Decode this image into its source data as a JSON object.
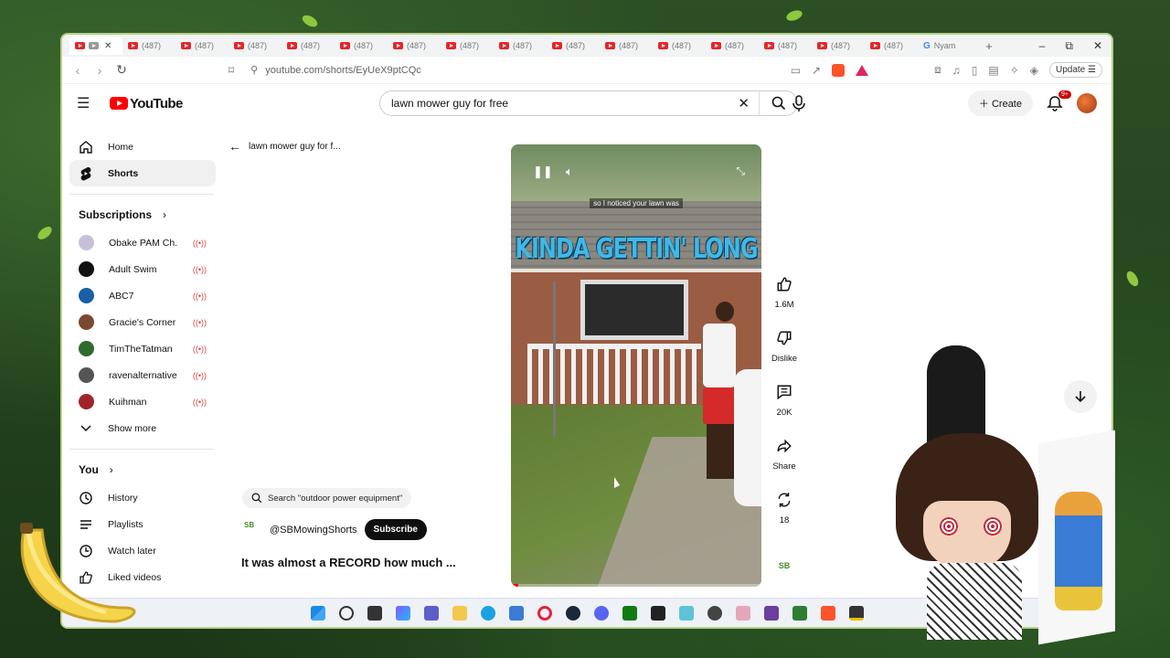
{
  "browser": {
    "tabs": [
      {
        "label": "",
        "active": true
      },
      {
        "label": "(487)"
      },
      {
        "label": "(487)"
      },
      {
        "label": "(487)"
      },
      {
        "label": "(487)"
      },
      {
        "label": "(487)"
      },
      {
        "label": "(487)"
      },
      {
        "label": "(487)"
      },
      {
        "label": "(487)"
      },
      {
        "label": "(487)"
      },
      {
        "label": "(487)"
      },
      {
        "label": "(487)"
      },
      {
        "label": "(487)"
      },
      {
        "label": "(487)"
      },
      {
        "label": "(487)"
      },
      {
        "label": "(487)"
      }
    ],
    "last_tab_label": "Nyam",
    "url": "youtube.com/shorts/EyUeX9ptCQc",
    "update_label": "Update"
  },
  "header": {
    "logo_text": "YouTube",
    "search_value": "lawn mower guy for free",
    "create_label": "Create",
    "notifications_badge": "9+"
  },
  "sidebar": {
    "home": "Home",
    "shorts": "Shorts",
    "subscriptions_label": "Subscriptions",
    "subscriptions": [
      {
        "name": "Obake PAM Ch.",
        "color": "#c8c0d8"
      },
      {
        "name": "Adult Swim",
        "color": "#111111"
      },
      {
        "name": "ABC7",
        "color": "#1a5fa8"
      },
      {
        "name": "Gracie's Corner",
        "color": "#7a4a30"
      },
      {
        "name": "TimTheTatman",
        "color": "#2f6b2f"
      },
      {
        "name": "ravenalternative",
        "color": "#555555"
      },
      {
        "name": "Kuihman",
        "color": "#a0252a"
      }
    ],
    "show_more": "Show more",
    "you_label": "You",
    "you_items": [
      "History",
      "Playlists",
      "Watch later",
      "Liked videos"
    ]
  },
  "shorts": {
    "back_label": "lawn mower guy for f...",
    "caption": "so I noticed your lawn was",
    "overlay_text": "KINDA GETTIN' LONG",
    "search_chip": "Search \"outdoor power equipment\"",
    "channel": "@SBMowingShorts",
    "channel_logo": "SB",
    "subscribe_label": "Subscribe",
    "title": "It was almost a RECORD how much ...",
    "progress": 0.03,
    "actions": {
      "like_count": "1.6M",
      "dislike_label": "Dislike",
      "comment_count": "20K",
      "share_label": "Share",
      "remix_count": "18"
    }
  },
  "colors": {
    "brand_red": "#ff0000",
    "live_red": "#e04040",
    "overlay_blue": "#3fb8e8"
  }
}
